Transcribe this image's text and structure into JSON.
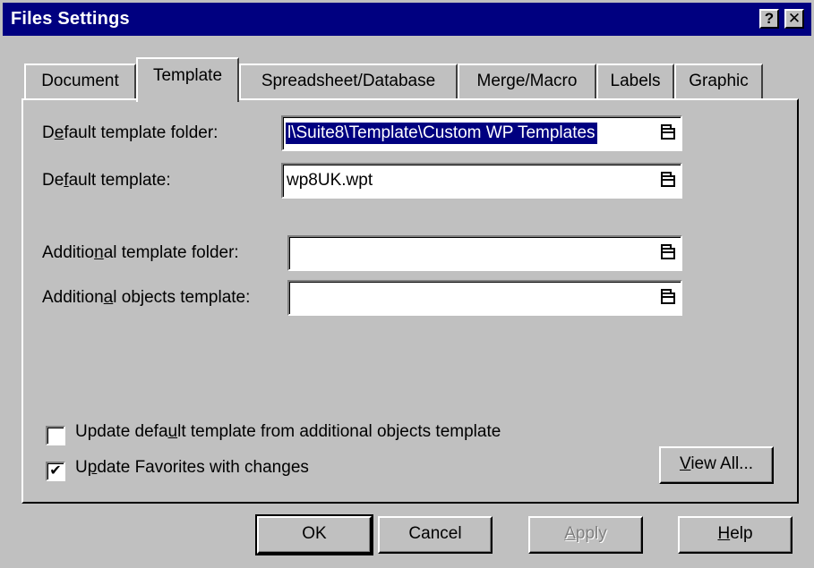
{
  "window": {
    "title": "Files Settings",
    "help_glyph": "?",
    "close_glyph": "✕"
  },
  "tabs": [
    {
      "label": "Document",
      "active": false
    },
    {
      "label": "Template",
      "active": true
    },
    {
      "label": "Spreadsheet/Database",
      "active": false
    },
    {
      "label": "Merge/Macro",
      "active": false
    },
    {
      "label": "Labels",
      "active": false
    },
    {
      "label": "Graphic",
      "active": false
    }
  ],
  "fields": {
    "default_template_folder": {
      "label_pre": "D",
      "label_ul": "e",
      "label_post": "fault template folder:",
      "value": "l\\Suite8\\Template\\Custom WP Templates"
    },
    "default_template": {
      "label_pre": "De",
      "label_ul": "f",
      "label_post": "ault template:",
      "value": "wp8UK.wpt"
    },
    "additional_template_folder": {
      "label_pre": "Additio",
      "label_ul": "n",
      "label_post": "al template folder:",
      "value": ""
    },
    "additional_objects_template": {
      "label_pre": "Addition",
      "label_ul": "a",
      "label_post": "l objects template:",
      "value": ""
    }
  },
  "checkboxes": {
    "update_default": {
      "label_pre": "Update defa",
      "label_ul": "u",
      "label_post": "lt template from additional objects template",
      "checked": false,
      "mark": ""
    },
    "update_favorites": {
      "label_pre": "U",
      "label_ul": "p",
      "label_post": "date Favorites with changes",
      "checked": true,
      "mark": "✔"
    }
  },
  "buttons": {
    "view_all": {
      "pre": "",
      "ul": "V",
      "post": "iew All..."
    },
    "ok": {
      "pre": "",
      "ul": "",
      "post": "OK"
    },
    "cancel": {
      "pre": "",
      "ul": "",
      "post": "Cancel"
    },
    "apply": {
      "pre": "",
      "ul": "A",
      "post": "pply"
    },
    "help": {
      "pre": "",
      "ul": "H",
      "post": "elp"
    }
  },
  "colors": {
    "titlebar": "#000080",
    "face": "#c0c0c0",
    "selection": "#000080"
  },
  "icons": {
    "browse": "folder-icon",
    "check": "checkmark-icon"
  }
}
